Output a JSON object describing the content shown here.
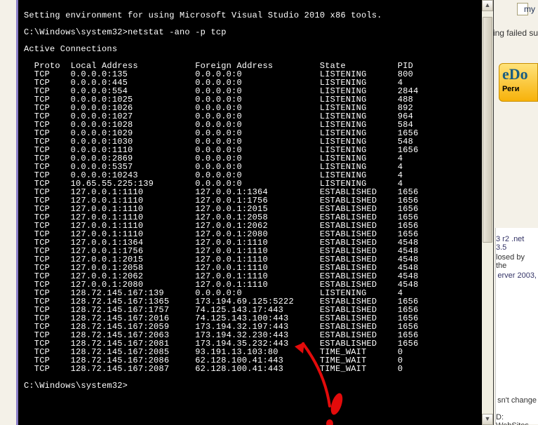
{
  "console": {
    "intro": "Setting environment for using Microsoft Visual Studio 2010 x86 tools.",
    "prompt_path": "C:\\Windows\\system32>",
    "command": "netstat -ano -p tcp",
    "active_header": "Active Connections",
    "columns": {
      "proto": "Proto",
      "local": "Local Address",
      "foreign": "Foreign Address",
      "state": "State",
      "pid": "PID"
    },
    "rows": [
      {
        "p": "TCP",
        "l": "0.0.0.0:135",
        "f": "0.0.0.0:0",
        "s": "LISTENING",
        "pid": "800"
      },
      {
        "p": "TCP",
        "l": "0.0.0.0:445",
        "f": "0.0.0.0:0",
        "s": "LISTENING",
        "pid": "4"
      },
      {
        "p": "TCP",
        "l": "0.0.0.0:554",
        "f": "0.0.0.0:0",
        "s": "LISTENING",
        "pid": "2844"
      },
      {
        "p": "TCP",
        "l": "0.0.0.0:1025",
        "f": "0.0.0.0:0",
        "s": "LISTENING",
        "pid": "488"
      },
      {
        "p": "TCP",
        "l": "0.0.0.0:1026",
        "f": "0.0.0.0:0",
        "s": "LISTENING",
        "pid": "892"
      },
      {
        "p": "TCP",
        "l": "0.0.0.0:1027",
        "f": "0.0.0.0:0",
        "s": "LISTENING",
        "pid": "964"
      },
      {
        "p": "TCP",
        "l": "0.0.0.0:1028",
        "f": "0.0.0.0:0",
        "s": "LISTENING",
        "pid": "584"
      },
      {
        "p": "TCP",
        "l": "0.0.0.0:1029",
        "f": "0.0.0.0:0",
        "s": "LISTENING",
        "pid": "1656"
      },
      {
        "p": "TCP",
        "l": "0.0.0.0:1030",
        "f": "0.0.0.0:0",
        "s": "LISTENING",
        "pid": "548"
      },
      {
        "p": "TCP",
        "l": "0.0.0.0:1110",
        "f": "0.0.0.0:0",
        "s": "LISTENING",
        "pid": "1656"
      },
      {
        "p": "TCP",
        "l": "0.0.0.0:2869",
        "f": "0.0.0.0:0",
        "s": "LISTENING",
        "pid": "4"
      },
      {
        "p": "TCP",
        "l": "0.0.0.0:5357",
        "f": "0.0.0.0:0",
        "s": "LISTENING",
        "pid": "4"
      },
      {
        "p": "TCP",
        "l": "0.0.0.0:10243",
        "f": "0.0.0.0:0",
        "s": "LISTENING",
        "pid": "4"
      },
      {
        "p": "TCP",
        "l": "10.65.55.225:139",
        "f": "0.0.0.0:0",
        "s": "LISTENING",
        "pid": "4"
      },
      {
        "p": "TCP",
        "l": "127.0.0.1:1110",
        "f": "127.0.0.1:1364",
        "s": "ESTABLISHED",
        "pid": "1656"
      },
      {
        "p": "TCP",
        "l": "127.0.0.1:1110",
        "f": "127.0.0.1:1756",
        "s": "ESTABLISHED",
        "pid": "1656"
      },
      {
        "p": "TCP",
        "l": "127.0.0.1:1110",
        "f": "127.0.0.1:2015",
        "s": "ESTABLISHED",
        "pid": "1656"
      },
      {
        "p": "TCP",
        "l": "127.0.0.1:1110",
        "f": "127.0.0.1:2058",
        "s": "ESTABLISHED",
        "pid": "1656"
      },
      {
        "p": "TCP",
        "l": "127.0.0.1:1110",
        "f": "127.0.0.1:2062",
        "s": "ESTABLISHED",
        "pid": "1656"
      },
      {
        "p": "TCP",
        "l": "127.0.0.1:1110",
        "f": "127.0.0.1:2080",
        "s": "ESTABLISHED",
        "pid": "1656"
      },
      {
        "p": "TCP",
        "l": "127.0.0.1:1364",
        "f": "127.0.0.1:1110",
        "s": "ESTABLISHED",
        "pid": "4548"
      },
      {
        "p": "TCP",
        "l": "127.0.0.1:1756",
        "f": "127.0.0.1:1110",
        "s": "ESTABLISHED",
        "pid": "4548"
      },
      {
        "p": "TCP",
        "l": "127.0.0.1:2015",
        "f": "127.0.0.1:1110",
        "s": "ESTABLISHED",
        "pid": "4548"
      },
      {
        "p": "TCP",
        "l": "127.0.0.1:2058",
        "f": "127.0.0.1:1110",
        "s": "ESTABLISHED",
        "pid": "4548"
      },
      {
        "p": "TCP",
        "l": "127.0.0.1:2062",
        "f": "127.0.0.1:1110",
        "s": "ESTABLISHED",
        "pid": "4548"
      },
      {
        "p": "TCP",
        "l": "127.0.0.1:2080",
        "f": "127.0.0.1:1110",
        "s": "ESTABLISHED",
        "pid": "4548"
      },
      {
        "p": "TCP",
        "l": "128.72.145.167:139",
        "f": "0.0.0.0:0",
        "s": "LISTENING",
        "pid": "4"
      },
      {
        "p": "TCP",
        "l": "128.72.145.167:1365",
        "f": "173.194.69.125:5222",
        "s": "ESTABLISHED",
        "pid": "1656"
      },
      {
        "p": "TCP",
        "l": "128.72.145.167:1757",
        "f": "74.125.143.17:443",
        "s": "ESTABLISHED",
        "pid": "1656"
      },
      {
        "p": "TCP",
        "l": "128.72.145.167:2016",
        "f": "74.125.143.100:443",
        "s": "ESTABLISHED",
        "pid": "1656"
      },
      {
        "p": "TCP",
        "l": "128.72.145.167:2059",
        "f": "173.194.32.197:443",
        "s": "ESTABLISHED",
        "pid": "1656"
      },
      {
        "p": "TCP",
        "l": "128.72.145.167:2063",
        "f": "173.194.32.230:443",
        "s": "ESTABLISHED",
        "pid": "1656"
      },
      {
        "p": "TCP",
        "l": "128.72.145.167:2081",
        "f": "173.194.35.232:443",
        "s": "ESTABLISHED",
        "pid": "1656"
      },
      {
        "p": "TCP",
        "l": "128.72.145.167:2085",
        "f": "93.191.13.103:80",
        "s": "TIME_WAIT",
        "pid": "0"
      },
      {
        "p": "TCP",
        "l": "128.72.145.167:2086",
        "f": "62.128.100.41:443",
        "s": "TIME_WAIT",
        "pid": "0"
      },
      {
        "p": "TCP",
        "l": "128.72.145.167:2087",
        "f": "62.128.100.41:443",
        "s": "TIME_WAIT",
        "pid": "0"
      }
    ],
    "prompt2": "C:\\Windows\\system32>"
  },
  "bg": {
    "my": "my",
    "failed": "ing failed su",
    "edoc_top": "eDo",
    "edoc_bot": "Реги",
    "r1": "3 r2 .net 3.5",
    "r2": "losed by the",
    "r3": "erver 2003,",
    "r4": "sn't change",
    "r5": "D: WebSites"
  },
  "annotation": {
    "color": "#e30b0b"
  }
}
